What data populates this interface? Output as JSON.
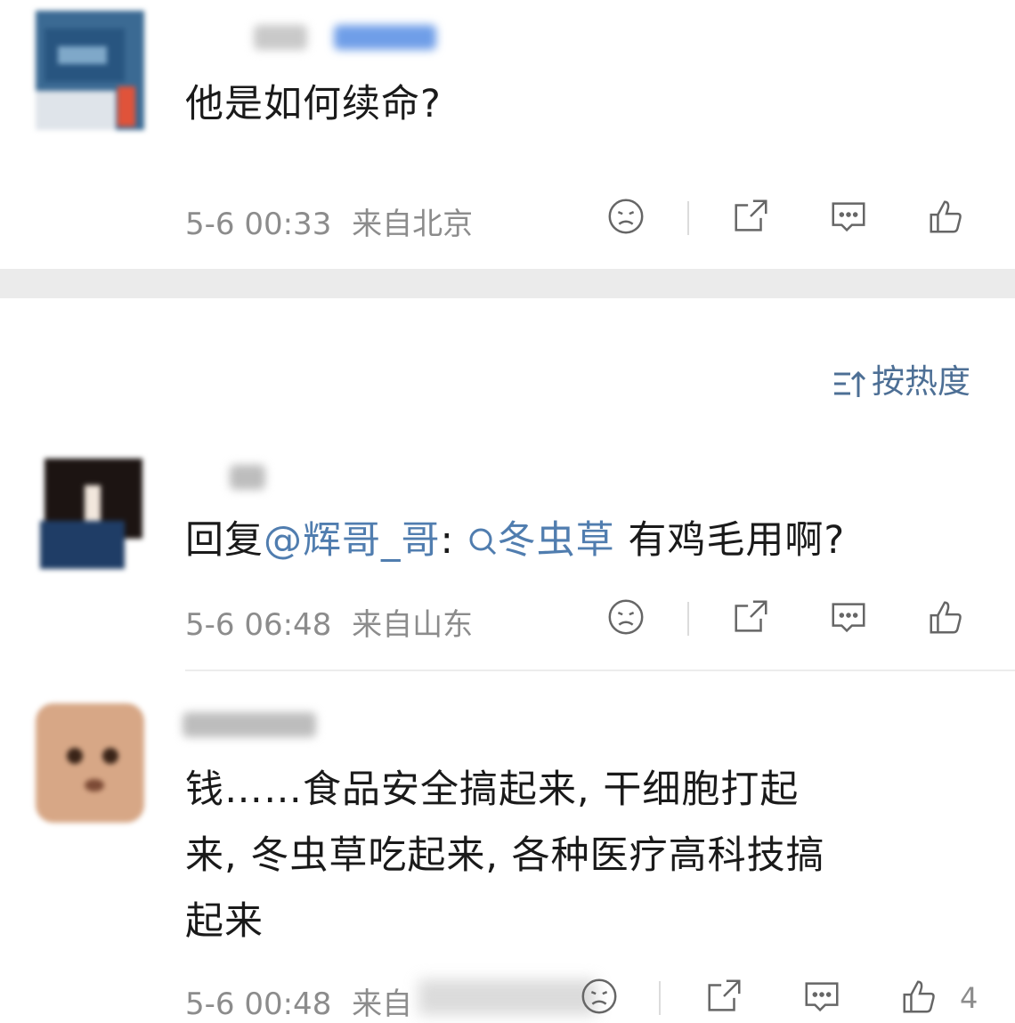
{
  "post": {
    "text": "他是如何续命?",
    "time": "5-6 00:33",
    "location": "来自北京"
  },
  "sort": {
    "label": "按热度",
    "icon": "sort-icon"
  },
  "comments": [
    {
      "reply_prefix": "回复",
      "mention": "@辉哥_哥",
      "colon": ":",
      "topic": "冬虫草",
      "rest": " 有鸡毛用啊?",
      "time": "5-6 06:48",
      "location": "来自山东"
    },
    {
      "line1": "钱……食品安全搞起来, 干细胞打起",
      "line2": "来, 冬虫草吃起来, 各种医疗高科技搞",
      "line3": "起来",
      "time": "5-6 00:48",
      "location": "来自",
      "like_count": "4"
    }
  ],
  "icons": [
    "sad-icon",
    "share-icon",
    "comment-icon",
    "like-icon",
    "search-icon"
  ],
  "colors": {
    "link": "#507daf",
    "meta": "#8c8c8c",
    "separator": "#ebebeb"
  }
}
